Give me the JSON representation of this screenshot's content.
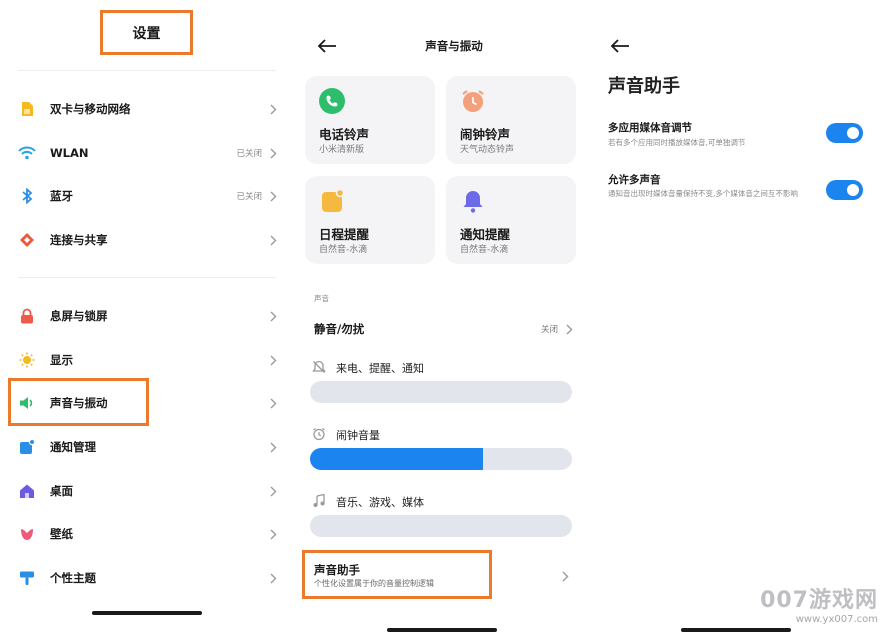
{
  "colors": {
    "accent": "#1b84ef",
    "highlight_border": "#ec7a2c",
    "card_bg": "#f4f4f6",
    "track": "#e3e5ec"
  },
  "settings": {
    "title": "设置",
    "items": [
      {
        "label": "双卡与移动网络",
        "status": "",
        "icon": "sim-card-icon"
      },
      {
        "label": "WLAN",
        "status": "已关闭",
        "icon": "wifi-icon"
      },
      {
        "label": "蓝牙",
        "status": "已关闭",
        "icon": "bluetooth-icon"
      },
      {
        "label": "连接与共享",
        "status": "",
        "icon": "connection-share-icon"
      },
      {
        "label": "息屏与锁屏",
        "status": "",
        "icon": "lock-icon"
      },
      {
        "label": "显示",
        "status": "",
        "icon": "sun-icon"
      },
      {
        "label": "声音与振动",
        "status": "",
        "icon": "speaker-icon"
      },
      {
        "label": "通知管理",
        "status": "",
        "icon": "notification-icon"
      },
      {
        "label": "桌面",
        "status": "",
        "icon": "home-icon"
      },
      {
        "label": "壁纸",
        "status": "",
        "icon": "tulip-icon"
      },
      {
        "label": "个性主题",
        "status": "",
        "icon": "brush-icon"
      }
    ]
  },
  "sound": {
    "title": "声音与振动",
    "cards": [
      {
        "title": "电话铃声",
        "subtitle": "小米清新版",
        "icon": "phone-icon"
      },
      {
        "title": "闹钟铃声",
        "subtitle": "天气动态铃声",
        "icon": "alarm-clock-icon"
      },
      {
        "title": "日程提醒",
        "subtitle": "自然音-水滴",
        "icon": "calendar-icon"
      },
      {
        "title": "通知提醒",
        "subtitle": "自然音-水滴",
        "icon": "bell-icon"
      }
    ],
    "section_label": "声音",
    "mute": {
      "label": "静音/勿扰",
      "status": "关闭"
    },
    "volumes": [
      {
        "label": "来电、提醒、通知",
        "icon": "bell-muted-icon",
        "level": 0
      },
      {
        "label": "闹钟音量",
        "icon": "alarm-icon",
        "level": 0.66
      },
      {
        "label": "音乐、游戏、媒体",
        "icon": "music-note-icon",
        "level": 0
      }
    ],
    "assistant": {
      "title": "声音助手",
      "subtitle": "个性化设置属于你的音量控制逻辑"
    }
  },
  "assistant": {
    "title": "声音助手",
    "options": [
      {
        "title": "多应用媒体音调节",
        "subtitle": "若有多个应用同时播放媒体音,可单独调节",
        "enabled": true
      },
      {
        "title": "允许多声音",
        "subtitle": "通知音出现时媒体音量保持不变,多个媒体音之间互不影响",
        "enabled": true
      }
    ]
  },
  "watermark": {
    "main": "007游戏网",
    "url": "www.yx007.com"
  }
}
